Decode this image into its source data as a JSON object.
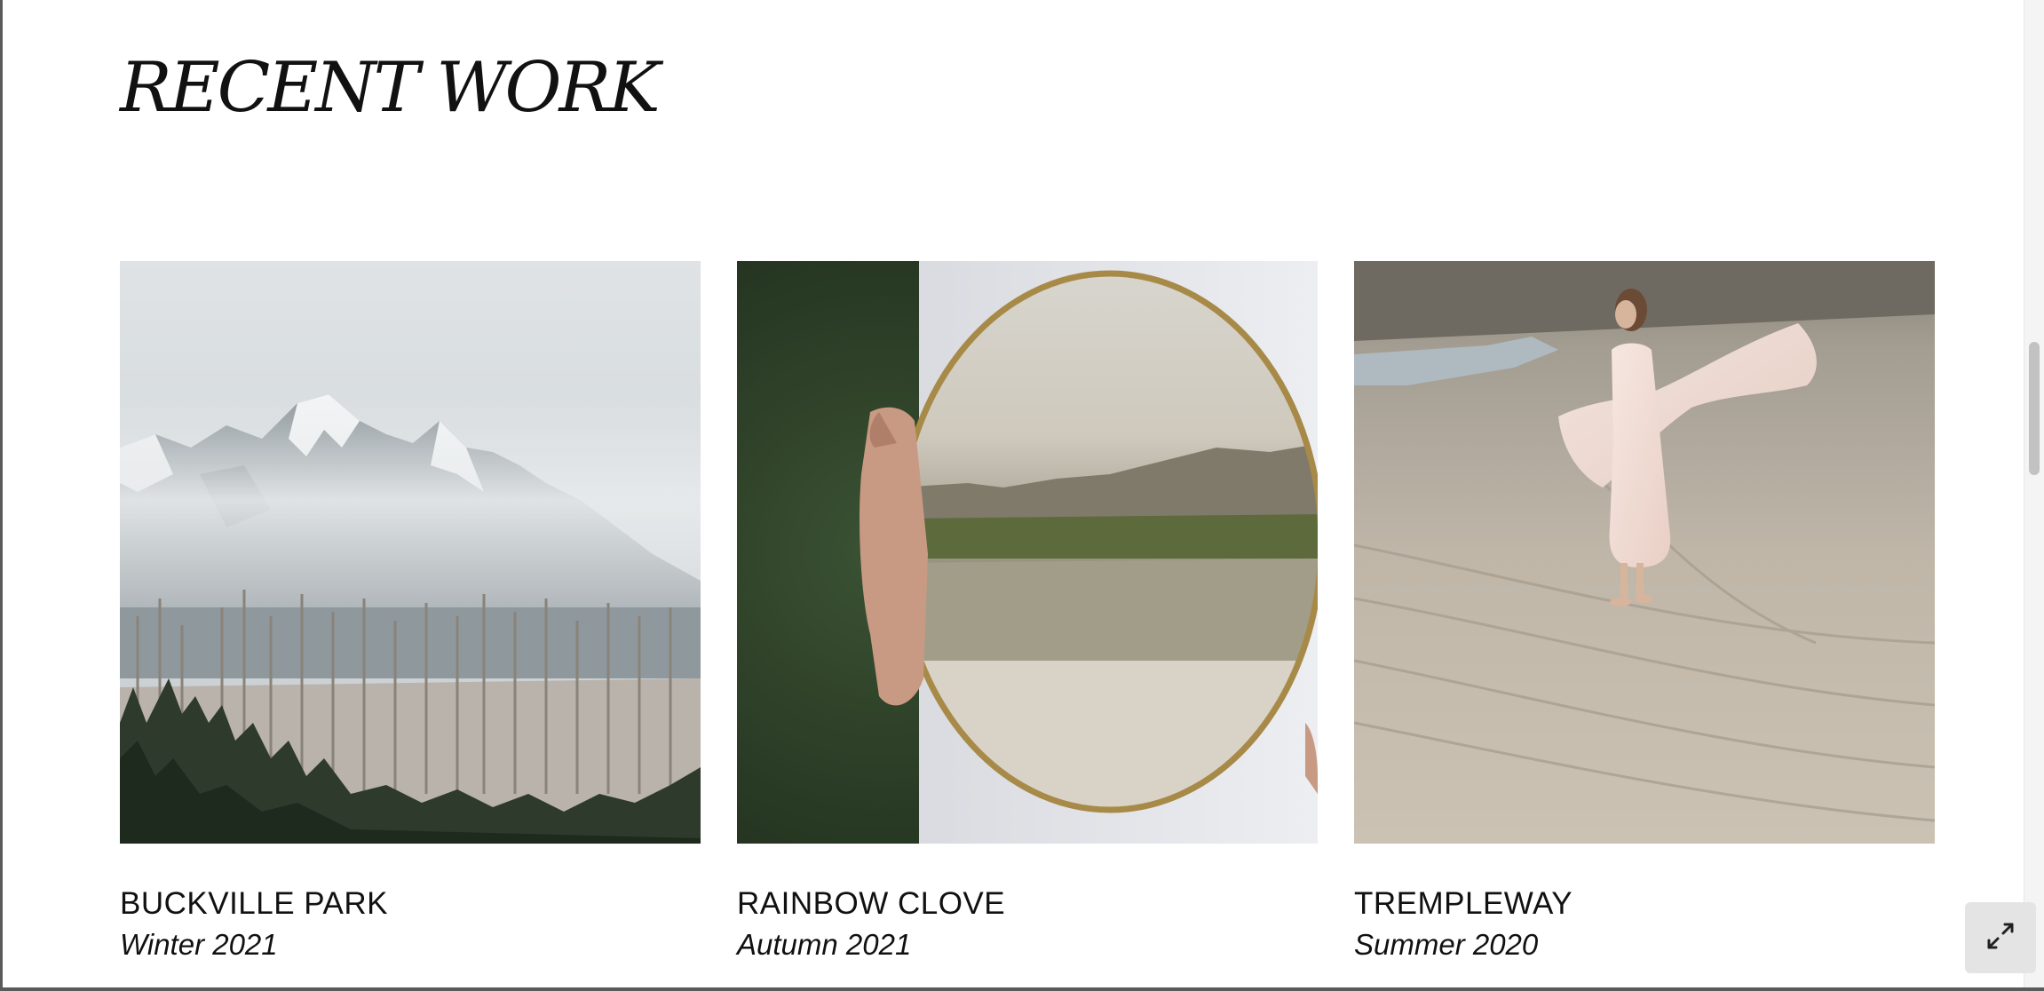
{
  "section": {
    "title": "RECENT WORK"
  },
  "projects": [
    {
      "title": "BUCKVILLE PARK",
      "season": "Winter 2021",
      "image": "misty-mountains-forest"
    },
    {
      "title": "RAINBOW CLOVE",
      "season": "Autumn 2021",
      "image": "hand-holding-mirror-lake"
    },
    {
      "title": "TREMPLEWAY",
      "season": "Summer 2020",
      "image": "woman-dancing-on-beach"
    }
  ],
  "controls": {
    "expand_icon": "expand-arrows-icon"
  }
}
